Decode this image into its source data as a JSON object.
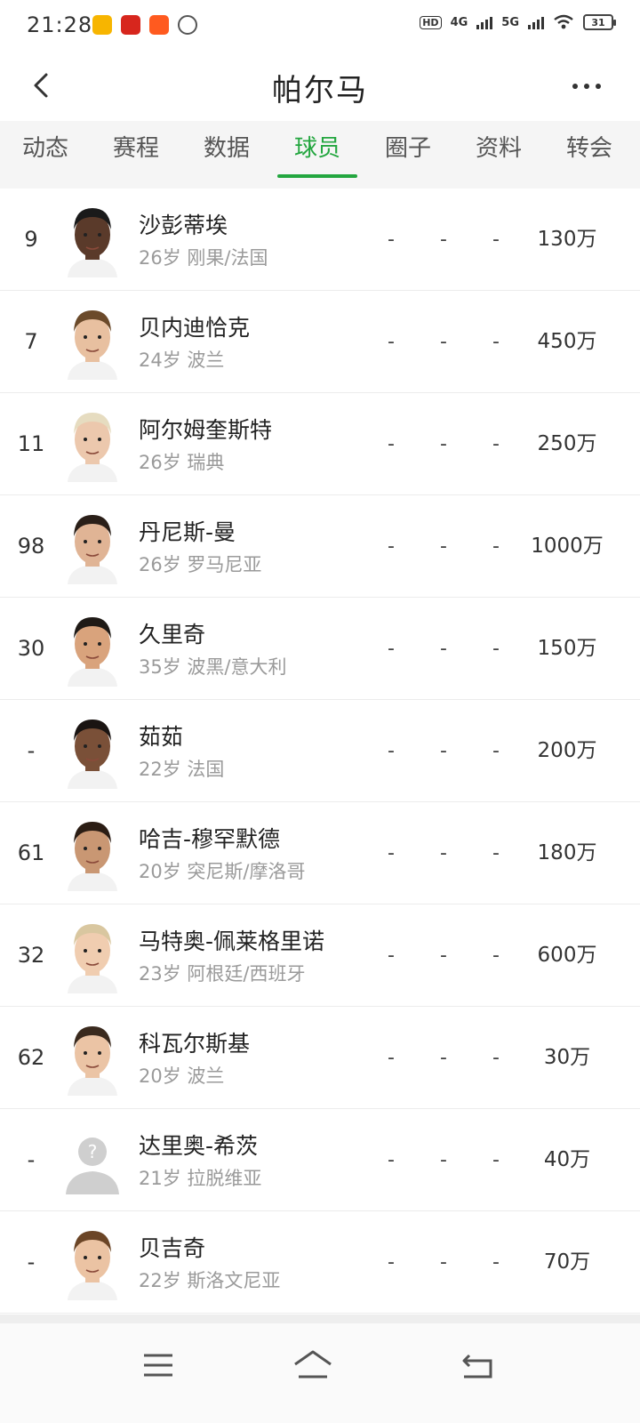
{
  "status": {
    "time": "21:28",
    "hd": "HD",
    "network1": "4G",
    "network2": "5G",
    "battery": "31"
  },
  "header": {
    "title": "帕尔马"
  },
  "tabs": [
    {
      "label": "动态"
    },
    {
      "label": "赛程"
    },
    {
      "label": "数据"
    },
    {
      "label": "球员",
      "active": true
    },
    {
      "label": "圈子"
    },
    {
      "label": "资料"
    },
    {
      "label": "转会"
    }
  ],
  "players": [
    {
      "number": "9",
      "name": "沙彭蒂埃",
      "info": "26岁 刚果/法国",
      "c1": "-",
      "c2": "-",
      "c3": "-",
      "value": "130万",
      "skin": "#5a3a2a",
      "hair": "#1a1a1a"
    },
    {
      "number": "7",
      "name": "贝内迪恰克",
      "info": "24岁 波兰",
      "c1": "-",
      "c2": "-",
      "c3": "-",
      "value": "450万",
      "skin": "#e8c0a0",
      "hair": "#6b4a2a"
    },
    {
      "number": "11",
      "name": "阿尔姆奎斯特",
      "info": "26岁 瑞典",
      "c1": "-",
      "c2": "-",
      "c3": "-",
      "value": "250万",
      "skin": "#ecc8ad",
      "hair": "#e6dcc0"
    },
    {
      "number": "98",
      "name": "丹尼斯-曼",
      "info": "26岁 罗马尼亚",
      "c1": "-",
      "c2": "-",
      "c3": "-",
      "value": "1000万",
      "skin": "#e0b495",
      "hair": "#2a1f18"
    },
    {
      "number": "30",
      "name": "久里奇",
      "info": "35岁 波黑/意大利",
      "c1": "-",
      "c2": "-",
      "c3": "-",
      "value": "150万",
      "skin": "#d9a37c",
      "hair": "#1f1a16"
    },
    {
      "number": "-",
      "name": "茹茹",
      "info": "22岁 法国",
      "c1": "-",
      "c2": "-",
      "c3": "-",
      "value": "200万",
      "skin": "#7a5038",
      "hair": "#1a1412"
    },
    {
      "number": "61",
      "name": "哈吉-穆罕默德",
      "info": "20岁 突尼斯/摩洛哥",
      "c1": "-",
      "c2": "-",
      "c3": "-",
      "value": "180万",
      "skin": "#c99773",
      "hair": "#2b1d14"
    },
    {
      "number": "32",
      "name": "马特奥-佩莱格里诺",
      "info": "23岁 阿根廷/西班牙",
      "c1": "-",
      "c2": "-",
      "c3": "-",
      "value": "600万",
      "skin": "#f0cdb0",
      "hair": "#d9c7a0"
    },
    {
      "number": "62",
      "name": "科瓦尔斯基",
      "info": "20岁 波兰",
      "c1": "-",
      "c2": "-",
      "c3": "-",
      "value": "30万",
      "skin": "#ebc4a5",
      "hair": "#3a2a1e"
    },
    {
      "number": "-",
      "name": "达里奥-希茨",
      "info": "21岁 拉脱维亚",
      "c1": "-",
      "c2": "-",
      "c3": "-",
      "value": "40万",
      "placeholder": true
    },
    {
      "number": "-",
      "name": "贝吉奇",
      "info": "22岁 斯洛文尼亚",
      "c1": "-",
      "c2": "-",
      "c3": "-",
      "value": "70万",
      "skin": "#ebc3a3",
      "hair": "#6b4526"
    }
  ],
  "colors": {
    "accent": "#23a63f"
  }
}
